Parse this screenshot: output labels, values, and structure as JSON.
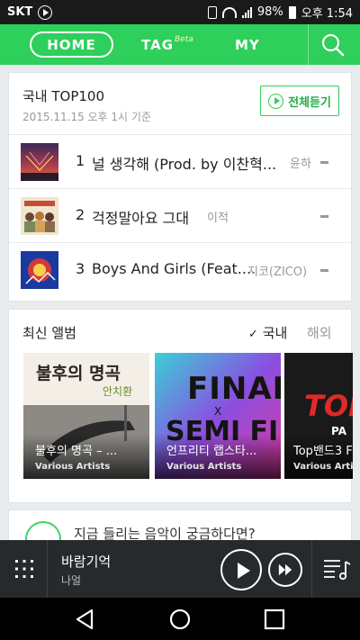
{
  "status_bar": {
    "carrier": "SKT",
    "battery": "98%",
    "time": "오후 1:54"
  },
  "header": {
    "tabs": [
      "HOME",
      "TAG",
      "MY"
    ],
    "tag_badge": "Beta",
    "active_tab": "HOME",
    "accent_color": "#2ecf5a"
  },
  "top100": {
    "title": "국내 TOP100",
    "subtitle": "2015.11.15 오후 1시 기준",
    "play_all_label": "전체듣기",
    "rows": [
      {
        "rank": "1",
        "song": "널 생각해 (Prod. by 이찬혁...",
        "artist": "윤하"
      },
      {
        "rank": "2",
        "song": "걱정말아요 그대",
        "artist": "이적"
      },
      {
        "rank": "3",
        "song": "Boys And Girls (Feat....",
        "artist": "지코(ZICO)"
      }
    ]
  },
  "new_albums": {
    "title": "최신 앨범",
    "tab_domestic": "국내",
    "tab_foreign": "해외",
    "albums": [
      {
        "title": "불후의 명곡 – ...",
        "artist": "Various Artists",
        "cover_text": "불후의 명곡",
        "cover_sub": "안치환"
      },
      {
        "title": "언프리티 랩스타...",
        "artist": "Various Artists",
        "cover_text": "FINAL",
        "cover_x": "X",
        "cover_sub": "SEMI FINAL"
      },
      {
        "title": "Top밴드3 F",
        "artist": "Various Artists",
        "cover_text": "TOP",
        "cover_sub": "PA"
      }
    ]
  },
  "teaser": {
    "text": "지금 들리는 음악이 궁금하다면?"
  },
  "player": {
    "song": "바람기억",
    "artist": "나얼"
  }
}
